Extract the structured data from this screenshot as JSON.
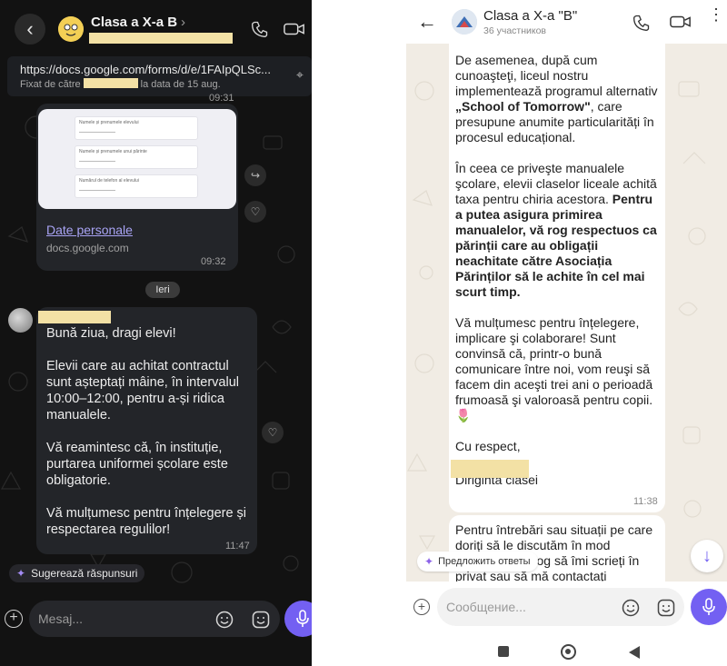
{
  "left_chat": {
    "header": {
      "back_icon": "chevron-left-icon",
      "title": "Clasa a X-a B",
      "title_chevron": "›",
      "call_icon": "phone-icon",
      "video_icon": "video-icon"
    },
    "pinned": {
      "url": "https://docs.google.com/forms/d/e/1FAIpQLSc...",
      "prefix": "Fixat de către",
      "suffix": "la data de 15 aug.",
      "icon": "unpin-icon"
    },
    "pinned_time": "09:31",
    "link_message": {
      "preview_fields": [
        "Numele și prenumele elevului",
        "Numele și prenumele unui părinte",
        "Numărul de telefon al elevului"
      ],
      "link_title": "Date personale",
      "domain": "docs.google.com",
      "time": "09:32"
    },
    "date_chip": "Ieri",
    "text_message": {
      "body": "Bună ziua, dragi elevi!\n\nElevii care au achitat contractul sunt așteptați mâine, în intervalul 10:00–12:00, pentru a-și ridica manualele.\n\nVă reamintesc că, în instituție, purtarea uniformei școlare este obligatorie.\n\nVă mulțumesc pentru înțelegere și respectarea regulilor!",
      "time": "11:47"
    },
    "suggest_label": "Sugerează răspunsuri",
    "input_placeholder": "Mesaj..."
  },
  "right_chat": {
    "header": {
      "title": "Clasa a X-a \"B\"",
      "subtitle": "36 участников"
    },
    "message": {
      "p1_a": "De asemenea, după cum cunoaşteţi, liceul nostru implementează programul alternativ ",
      "p1_bold": "„School of Tomorrow\"",
      "p1_b": ", care presupune anumite particularități în procesul educațional.",
      "p2_a": "În ceea ce priveşte manualele şcolare, elevii claselor liceale achită taxa pentru chiria acestora. ",
      "p2_bold": "Pentru a putea asigura primirea manualelor, vă rog respectuos ca părinții care au obligații neachitate către Asociația Părinților să le achite în cel mai scurt timp.",
      "p3": "Vă mulțumesc pentru înțelegere, implicare şi colaborare! Sunt convinsă că, printr-o bună comunicare între noi, vom reuşi să facem din aceşti trei ani o perioadă frumoasă şi valoroasă pentru copii.",
      "p3_emoji": "🌷",
      "closing": "Cu respect,",
      "signature_role": "Diriginta clasei",
      "time": "11:38"
    },
    "message2": "Pentru întrebări sau situații pe care doriți să le discutăm în mod individual, vă rog să îmi scrieți în privat sau să mă contactați",
    "suggest_label": "Предложить ответы",
    "input_placeholder": "Сообщение...",
    "scroll_down_icon": "arrow-down-icon"
  },
  "colors": {
    "dark_bg": "#121212",
    "dark_bubble": "#232529",
    "accent": "#7360f2",
    "link": "#a9a4f5",
    "redaction": "#f3e1a5",
    "light_bg": "#f1ece4"
  }
}
